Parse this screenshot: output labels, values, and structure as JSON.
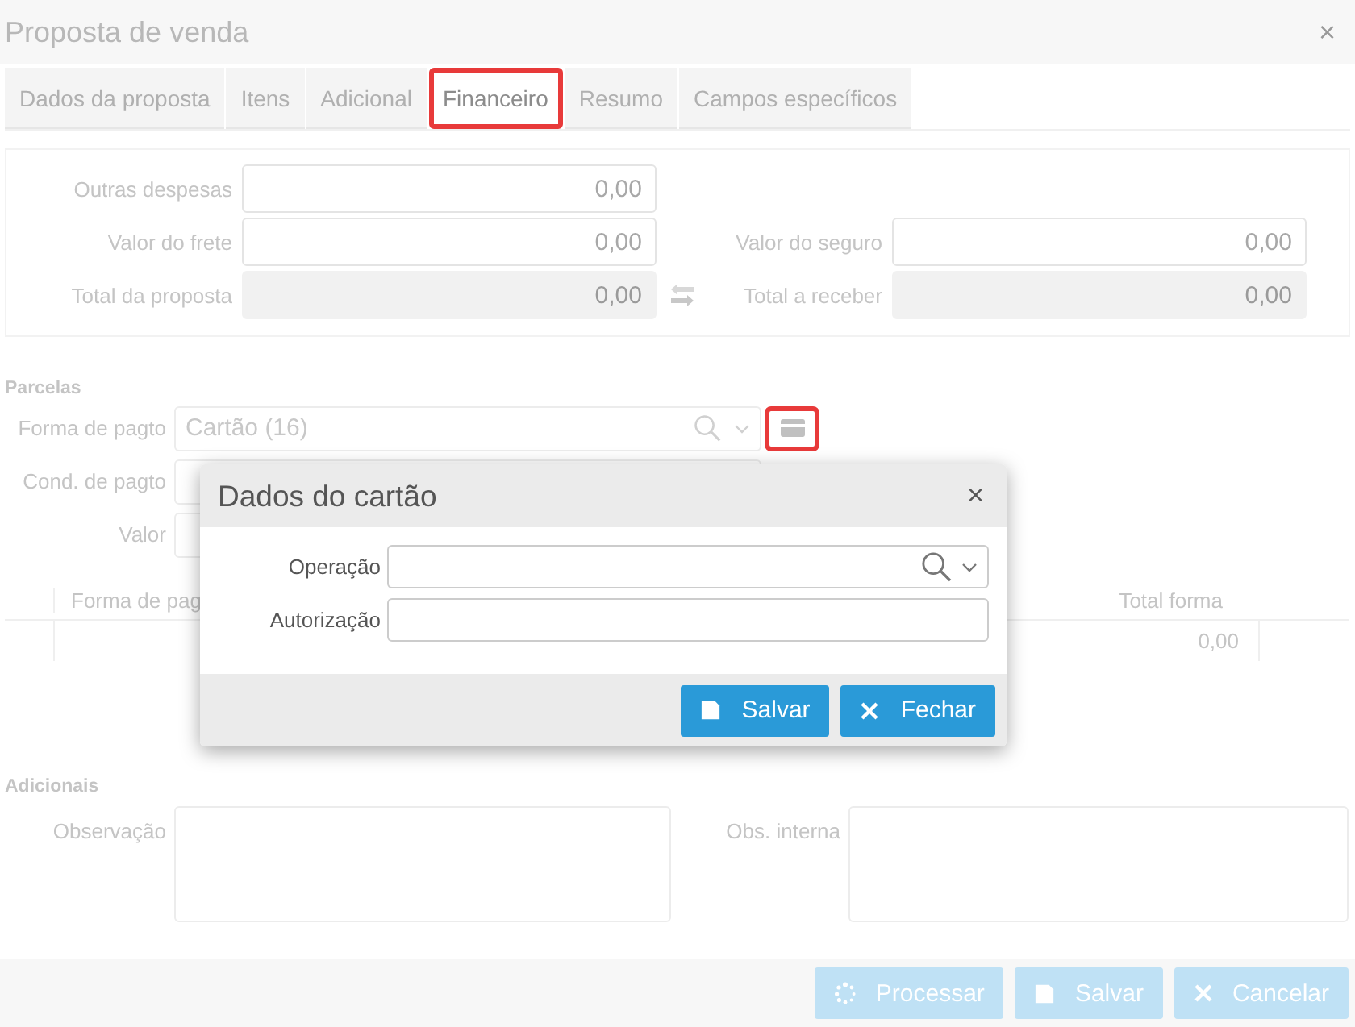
{
  "window": {
    "title": "Proposta de venda",
    "close": "×"
  },
  "tabs": [
    {
      "label": "Dados da proposta",
      "selected": false,
      "highlighted": false
    },
    {
      "label": "Itens",
      "selected": false,
      "highlighted": false
    },
    {
      "label": "Adicional",
      "selected": false,
      "highlighted": false
    },
    {
      "label": "Financeiro",
      "selected": true,
      "highlighted": true
    },
    {
      "label": "Resumo",
      "selected": false,
      "highlighted": false
    },
    {
      "label": "Campos específicos",
      "selected": false,
      "highlighted": false
    }
  ],
  "totals": {
    "rows": [
      {
        "transfer_icon": false,
        "fields": [
          {
            "label": "Outras despesas",
            "value": "0,00",
            "readonly": false
          }
        ]
      },
      {
        "transfer_icon": false,
        "fields": [
          {
            "label": "Valor do frete",
            "value": "0,00",
            "readonly": false
          },
          {
            "label": "Valor do seguro",
            "value": "0,00",
            "readonly": false
          }
        ]
      },
      {
        "transfer_icon": true,
        "fields": [
          {
            "label": "Total da proposta",
            "value": "0,00",
            "readonly": true
          },
          {
            "label": "Total a receber",
            "value": "0,00",
            "readonly": true
          }
        ]
      }
    ]
  },
  "parcelas": {
    "title": "Parcelas",
    "fields": [
      {
        "label": "Forma de pagto",
        "value": "Cartão (16)",
        "kind": "lookup"
      },
      {
        "label": "Cond. de pagto",
        "kind": "text"
      },
      {
        "label": "Valor",
        "kind": "text"
      }
    ],
    "card_button": {
      "highlighted": true
    },
    "table": {
      "columns": [
        "Forma de pag",
        "Total forma"
      ],
      "rows": [
        {
          "total": "0,00"
        }
      ]
    }
  },
  "adicionais": {
    "title": "Adicionais",
    "fields": [
      {
        "label": "Observação"
      },
      {
        "label": "Obs. interna"
      }
    ]
  },
  "footer_buttons": [
    {
      "label": "Processar",
      "kind": "process"
    },
    {
      "label": "Salvar",
      "kind": "save"
    },
    {
      "label": "Cancelar",
      "kind": "close"
    }
  ],
  "dialog": {
    "title": "Dados do cartão",
    "close": "×",
    "fields": [
      {
        "label": "Operação",
        "kind": "lookup"
      },
      {
        "label": "Autorização",
        "kind": "text"
      }
    ],
    "buttons": [
      {
        "label": "Salvar",
        "kind": "save"
      },
      {
        "label": "Fechar",
        "kind": "close"
      }
    ]
  }
}
